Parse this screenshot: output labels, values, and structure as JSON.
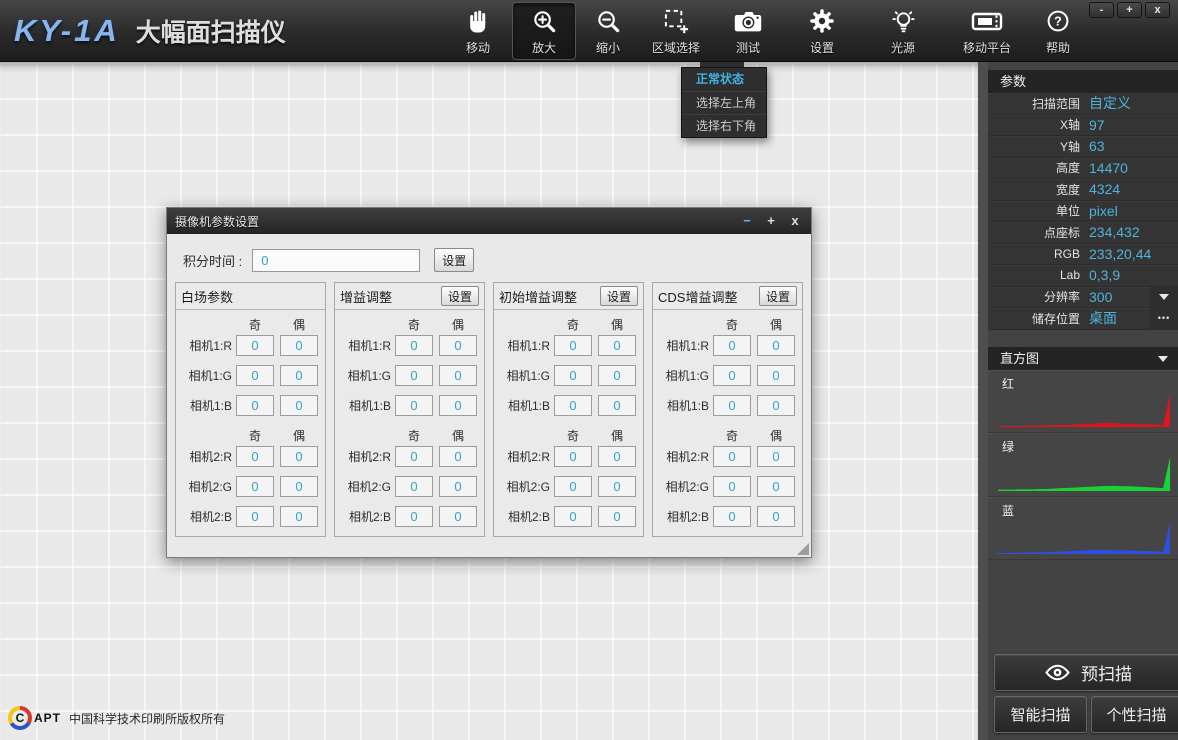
{
  "app": {
    "logo": "KY-1A",
    "title": "大幅面扫描仪"
  },
  "window_controls": {
    "minimize": "-",
    "maximize": "+",
    "close": "x"
  },
  "toolbar": {
    "items": [
      {
        "label": "移动",
        "icon": "hand-icon",
        "selected": false
      },
      {
        "label": "放大",
        "icon": "zoom-in-icon",
        "selected": true
      },
      {
        "label": "缩小",
        "icon": "zoom-out-icon",
        "selected": false
      },
      {
        "label": "区域选择",
        "icon": "area-select-icon",
        "selected": false
      },
      {
        "label": "测试",
        "icon": "camera-icon",
        "selected": false
      },
      {
        "label": "设置",
        "icon": "gear-icon",
        "selected": false
      },
      {
        "label": "光源",
        "icon": "light-bulb-icon",
        "selected": false
      },
      {
        "label": "移动平台",
        "icon": "platform-icon",
        "selected": false
      },
      {
        "label": "帮助",
        "icon": "help-icon",
        "selected": false
      }
    ]
  },
  "area_menu": {
    "items": [
      {
        "label": "正常状态",
        "active": true
      },
      {
        "label": "选择左上角",
        "active": false
      },
      {
        "label": "选择右下角",
        "active": false
      }
    ]
  },
  "dialog": {
    "title": "摄像机参数设置",
    "buttons": {
      "minimize": "−",
      "maximize": "+",
      "close": "x"
    },
    "integration": {
      "label": "积分时间 :",
      "value": "0",
      "set_label": "设置"
    },
    "col_headers": [
      "奇",
      "偶"
    ],
    "groups": [
      {
        "title": "白场参数",
        "set_label": null
      },
      {
        "title": "增益调整",
        "set_label": "设置"
      },
      {
        "title": "初始增益调整",
        "set_label": "设置"
      },
      {
        "title": "CDS增益调整",
        "set_label": "设置"
      }
    ],
    "blocks": [
      {
        "rows": [
          {
            "label": "相机1:R",
            "odd": "0",
            "even": "0"
          },
          {
            "label": "相机1:G",
            "odd": "0",
            "even": "0"
          },
          {
            "label": "相机1:B",
            "odd": "0",
            "even": "0"
          }
        ]
      },
      {
        "rows": [
          {
            "label": "相机2:R",
            "odd": "0",
            "even": "0"
          },
          {
            "label": "相机2:G",
            "odd": "0",
            "even": "0"
          },
          {
            "label": "相机2:B",
            "odd": "0",
            "even": "0"
          }
        ]
      }
    ]
  },
  "sidebar": {
    "params_title": "参数",
    "rows": [
      {
        "label": "扫描范围",
        "value": "自定义",
        "control": null
      },
      {
        "label": "X轴",
        "value": "97",
        "control": null
      },
      {
        "label": "Y轴",
        "value": "63",
        "control": null
      },
      {
        "label": "高度",
        "value": "14470",
        "control": null
      },
      {
        "label": "宽度",
        "value": "4324",
        "control": null
      },
      {
        "label": "单位",
        "value": "pixel",
        "control": null
      },
      {
        "label": "点座标",
        "value": "234,432",
        "control": null
      },
      {
        "label": "RGB",
        "value": "233,20,44",
        "control": null
      },
      {
        "label": "Lab",
        "value": "0,3,9",
        "control": null
      },
      {
        "label": "分辨率",
        "value": "300",
        "control": "dropdown"
      },
      {
        "label": "储存位置",
        "value": "桌面",
        "control": "ellipsis"
      }
    ],
    "histogram_title": "直方图",
    "histograms": [
      {
        "label": "红",
        "color": "#e01420",
        "values": [
          3,
          3,
          3,
          3,
          4,
          4,
          4,
          5,
          5,
          6,
          6,
          7,
          8,
          9,
          10,
          11,
          12,
          11,
          10,
          9,
          9,
          8,
          8,
          7,
          6,
          96
        ]
      },
      {
        "label": "绿",
        "color": "#17d435",
        "values": [
          4,
          4,
          4,
          5,
          5,
          5,
          6,
          6,
          7,
          8,
          9,
          10,
          11,
          12,
          13,
          14,
          15,
          15,
          14,
          14,
          13,
          12,
          11,
          10,
          8,
          100
        ]
      },
      {
        "label": "蓝",
        "color": "#2e4fe0",
        "values": [
          3,
          3,
          3,
          4,
          4,
          5,
          5,
          6,
          6,
          7,
          8,
          9,
          10,
          11,
          12,
          12,
          12,
          11,
          11,
          10,
          10,
          9,
          8,
          8,
          7,
          92
        ]
      }
    ],
    "prescan_button": "预扫描",
    "smart_scan_button": "智能扫描",
    "custom_scan_button": "个性扫描"
  },
  "footer": {
    "logo_c": "C",
    "logo_rest": "APT",
    "copyright": "中国科学技术印刷所版权所有"
  },
  "colors": {
    "accent": "#4fb3da",
    "menu_active": "#41b2e2",
    "hist_red": "#e01420",
    "hist_green": "#17d435",
    "hist_blue": "#2e4fe0"
  }
}
